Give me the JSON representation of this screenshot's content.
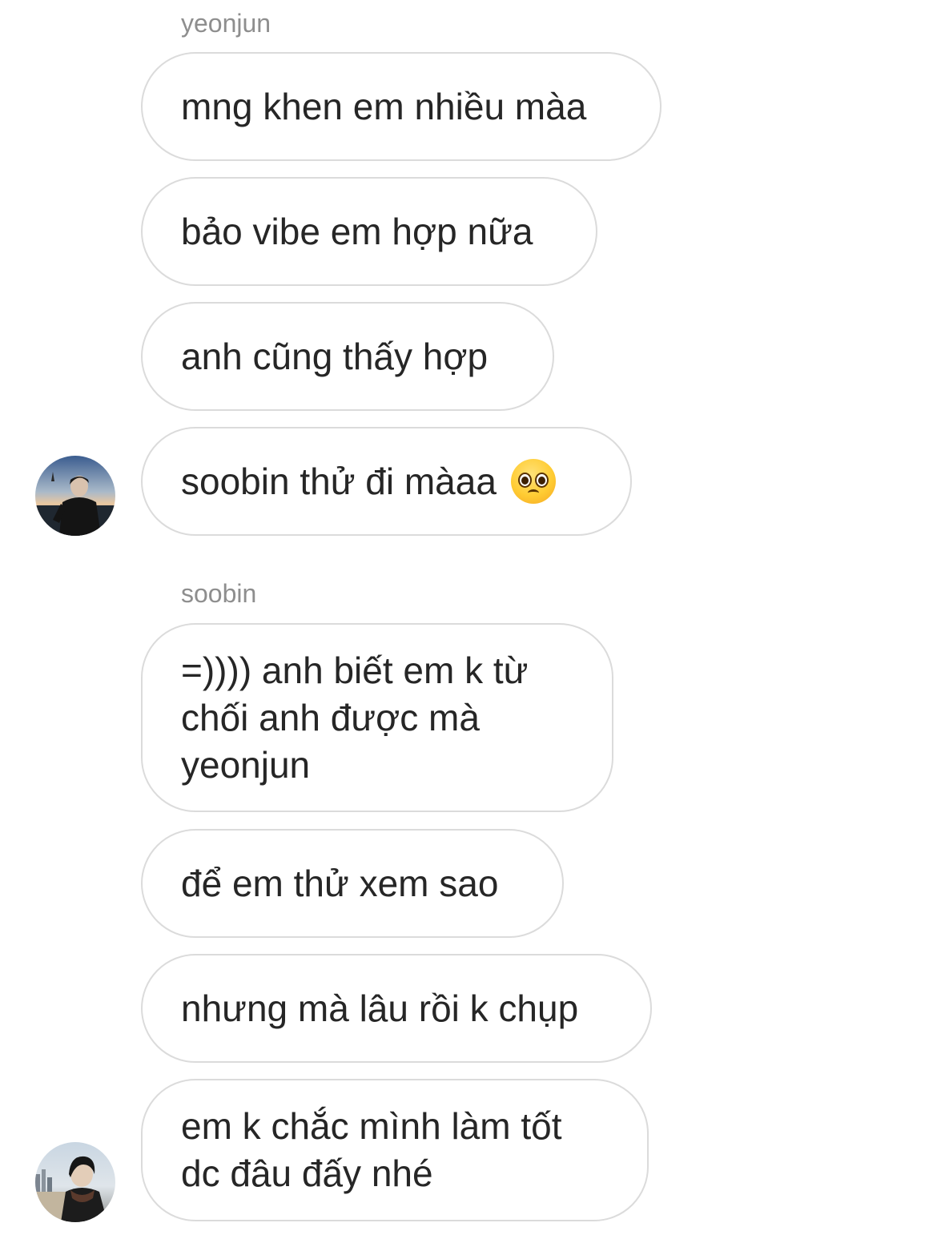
{
  "thread": {
    "groups": [
      {
        "sender": "yeonjun",
        "messages": [
          "mng khen em nhiều màa",
          "bảo vibe em hợp nữa",
          "anh cũng thấy hợp",
          "soobin thử đi màaa"
        ],
        "last_message_emoji": "pleading-face-emoji"
      },
      {
        "sender": "soobin",
        "messages": [
          {
            "lines": [
              "=)))) anh biết em k từ",
              "chối anh được mà",
              "yeonjun"
            ]
          },
          "để em thử xem sao",
          "nhưng mà lâu rồi k chụp",
          {
            "lines": [
              "em k chắc mình làm tốt",
              "dc đâu đấy nhé"
            ]
          }
        ]
      }
    ]
  },
  "colors": {
    "bubble_border": "#dbdbdb",
    "text": "#262626",
    "sender_label": "#8e8e8e",
    "background": "#ffffff"
  }
}
